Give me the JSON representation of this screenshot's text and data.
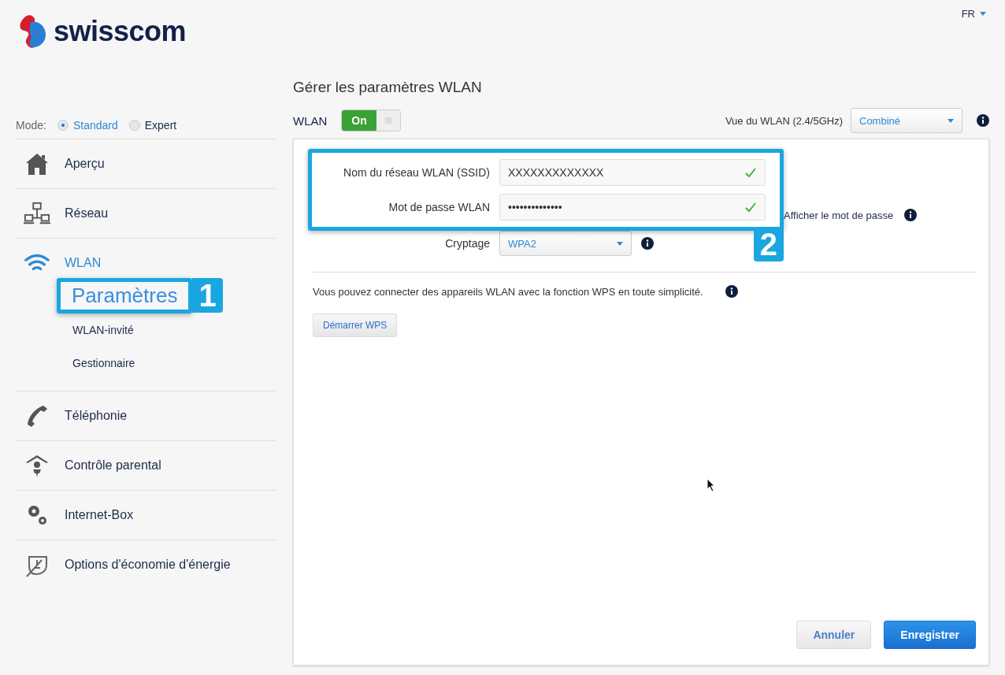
{
  "header": {
    "logo": "swisscom",
    "language": "FR"
  },
  "mode": {
    "label": "Mode:",
    "options": [
      {
        "label": "Standard",
        "selected": true
      },
      {
        "label": "Expert",
        "selected": false
      }
    ]
  },
  "nav": [
    {
      "label": "Aperçu",
      "selected": false
    },
    {
      "label": "Réseau",
      "selected": false
    },
    {
      "label": "WLAN",
      "selected": true,
      "children": [
        {
          "label": "Paramètres",
          "selected": true,
          "callout": "1"
        },
        {
          "label": "WLAN-invité",
          "selected": false
        },
        {
          "label": "Gestionnaire",
          "selected": false
        }
      ]
    },
    {
      "label": "Téléphonie",
      "selected": false
    },
    {
      "label": "Contrôle parental",
      "selected": false
    },
    {
      "label": "Internet-Box",
      "selected": false
    },
    {
      "label": "Options d'économie d'énergie",
      "selected": false
    }
  ],
  "main": {
    "title": "Gérer les paramètres WLAN",
    "wlan_label": "WLAN",
    "toggle": {
      "label": "On",
      "on": true
    },
    "view": {
      "label": "Vue du WLAN (2.4/5GHz)",
      "value": "Combiné"
    },
    "fields_callout": "2",
    "fields": [
      {
        "label": "Nom du réseau WLAN (SSID)",
        "value": "XXXXXXXXXXXXX",
        "valid": true
      },
      {
        "label": "Mot de passe WLAN",
        "value": "••••••••••••••",
        "valid": true
      }
    ],
    "show_password": "Afficher le mot de passe",
    "encryption": {
      "label": "Cryptage",
      "value": "WPA2"
    },
    "wps_text": "Vous pouvez connecter des appareils WLAN avec la fonction WPS en toute simplicité.",
    "wps_button": "Démarrer WPS",
    "buttons": [
      {
        "label": "Annuler",
        "kind": "secondary"
      },
      {
        "label": "Enregistrer",
        "kind": "primary"
      }
    ]
  }
}
